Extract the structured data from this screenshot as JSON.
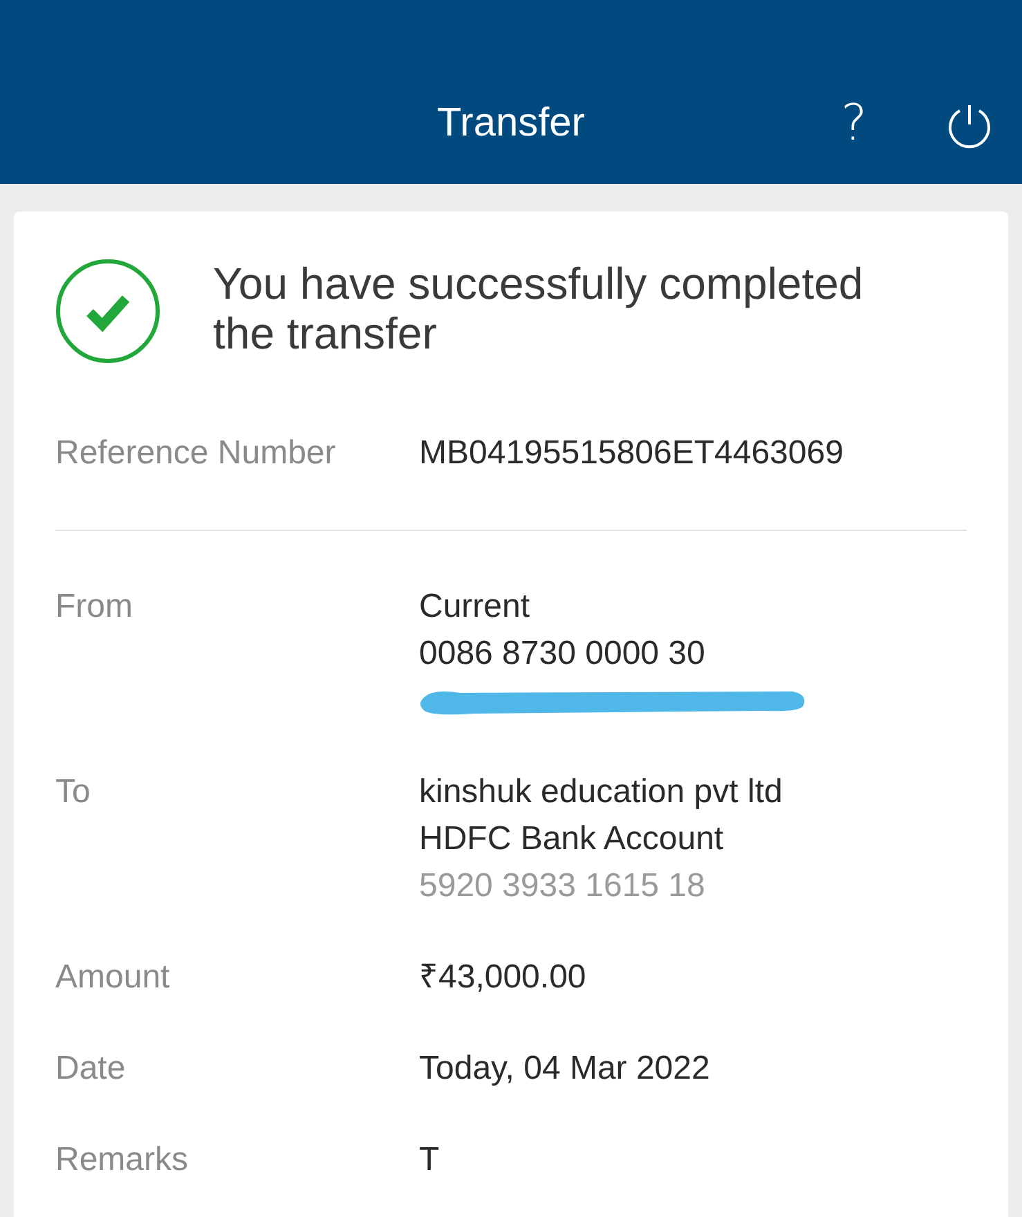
{
  "header": {
    "title": "Transfer",
    "help": "?"
  },
  "status": {
    "success": true,
    "message": "You have successfully completed the transfer"
  },
  "summary": [
    {
      "label": "Reference Number",
      "lines": [
        {
          "kind": "primary",
          "text": "MB04195515806ET4463069"
        }
      ]
    }
  ],
  "details": [
    {
      "label": "From",
      "lines": [
        {
          "kind": "primary",
          "text": "Current"
        },
        {
          "kind": "primary",
          "text": "0086 8730 0000 30"
        },
        {
          "kind": "redacted"
        }
      ]
    },
    {
      "label": "To",
      "lines": [
        {
          "kind": "primary",
          "text": "kinshuk education pvt ltd"
        },
        {
          "kind": "primary",
          "text": "HDFC Bank Account"
        },
        {
          "kind": "secondary",
          "text": "5920 3933 1615 18"
        }
      ]
    },
    {
      "label": "Amount",
      "lines": [
        {
          "kind": "primary",
          "text": "₹43,000.00"
        }
      ]
    },
    {
      "label": "Date",
      "lines": [
        {
          "kind": "primary",
          "text": "Today, 04 Mar 2022"
        }
      ]
    },
    {
      "label": "Remarks",
      "lines": [
        {
          "kind": "primary",
          "text": "T"
        }
      ]
    }
  ]
}
